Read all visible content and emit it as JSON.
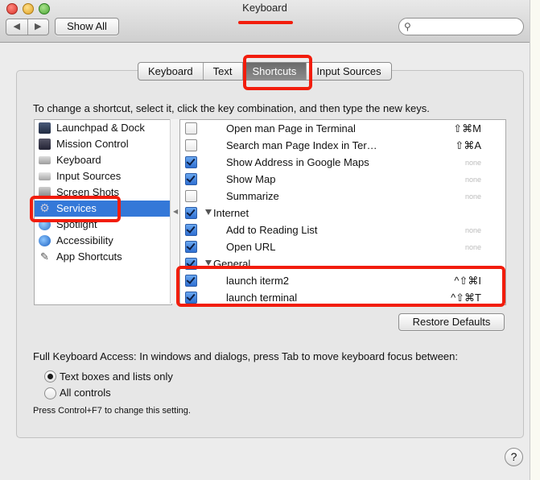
{
  "window": {
    "title": "Keyboard"
  },
  "toolbar": {
    "back_icon": "chevron-left",
    "forward_icon": "chevron-right",
    "show_all_label": "Show All",
    "search_placeholder": ""
  },
  "tabs": [
    {
      "label": "Keyboard",
      "selected": false
    },
    {
      "label": "Text",
      "selected": false
    },
    {
      "label": "Shortcuts",
      "selected": true
    },
    {
      "label": "Input Sources",
      "selected": false
    }
  ],
  "instructions": "To change a shortcut, select it, click the key combination, and then type the new keys.",
  "categories": [
    {
      "label": "Launchpad & Dock",
      "icon": "launchpad-icon",
      "selected": false
    },
    {
      "label": "Mission Control",
      "icon": "mission-control-icon",
      "selected": false
    },
    {
      "label": "Keyboard",
      "icon": "keyboard-icon",
      "selected": false
    },
    {
      "label": "Input Sources",
      "icon": "input-sources-icon",
      "selected": false
    },
    {
      "label": "Screen Shots",
      "icon": "screenshot-icon",
      "selected": false
    },
    {
      "label": "Services",
      "icon": "gear-icon",
      "selected": true
    },
    {
      "label": "Spotlight",
      "icon": "spotlight-icon",
      "selected": false
    },
    {
      "label": "Accessibility",
      "icon": "accessibility-icon",
      "selected": false
    },
    {
      "label": "App Shortcuts",
      "icon": "app-shortcuts-icon",
      "selected": false
    }
  ],
  "shortcuts": [
    {
      "label": "Open man Page in Terminal",
      "checked": false,
      "shortcut": "⇧⌘M",
      "none": false
    },
    {
      "label": "Search man Page Index in Ter…",
      "checked": false,
      "shortcut": "⇧⌘A",
      "none": false
    },
    {
      "label": "Show Address in Google Maps",
      "checked": true,
      "shortcut": "none",
      "none": true
    },
    {
      "label": "Show Map",
      "checked": true,
      "shortcut": "none",
      "none": true
    },
    {
      "label": "Summarize",
      "checked": false,
      "shortcut": "none",
      "none": true
    },
    {
      "label": "Internet",
      "checked": true,
      "group": true
    },
    {
      "label": "Add to Reading List",
      "checked": true,
      "shortcut": "none",
      "none": true
    },
    {
      "label": "Open URL",
      "checked": true,
      "shortcut": "none",
      "none": true
    },
    {
      "label": "General",
      "checked": true,
      "group": true
    },
    {
      "label": "launch iterm2",
      "checked": true,
      "shortcut": "^⇧⌘I",
      "none": false
    },
    {
      "label": "launch terminal",
      "checked": true,
      "shortcut": "^⇧⌘T",
      "none": false
    }
  ],
  "restore_defaults_label": "Restore Defaults",
  "full_keyboard_access": {
    "label": "Full Keyboard Access: In windows and dialogs, press Tab to move keyboard focus between:",
    "options": [
      {
        "label": "Text boxes and lists only",
        "selected": true
      },
      {
        "label": "All controls",
        "selected": false
      }
    ],
    "hint": "Press Control+F7 to change this setting."
  },
  "help_label": "?",
  "accent_colors": {
    "selection": "#3478d8",
    "annotation": "#f21d0c"
  }
}
